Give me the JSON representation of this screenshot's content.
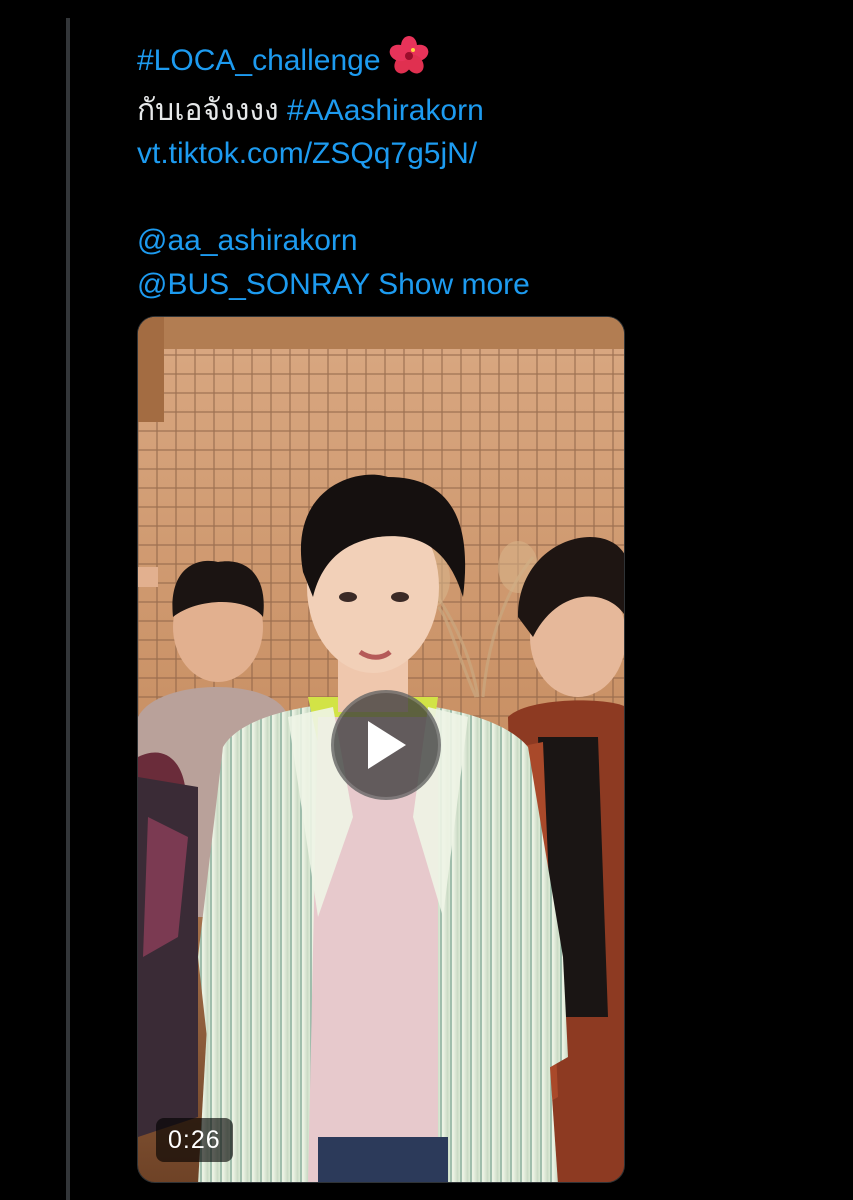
{
  "tweet": {
    "hashtag_challenge": "#LOCA_challenge",
    "emoji_icon": "hibiscus-icon",
    "thai_text": "กับเอจังงงง",
    "hashtag_name": "#AAashirakorn",
    "link": "vt.tiktok.com/ZSQq7g5jN/",
    "mention_1": "@aa_ashirakorn",
    "mention_2": "@BUS_SONRAY",
    "show_more": "Show more"
  },
  "video": {
    "duration": "0:26",
    "play_icon": "play-icon"
  },
  "colors": {
    "background": "#000000",
    "link": "#1d9bf0",
    "text": "#e7e9ea",
    "thread_line": "#333639"
  }
}
